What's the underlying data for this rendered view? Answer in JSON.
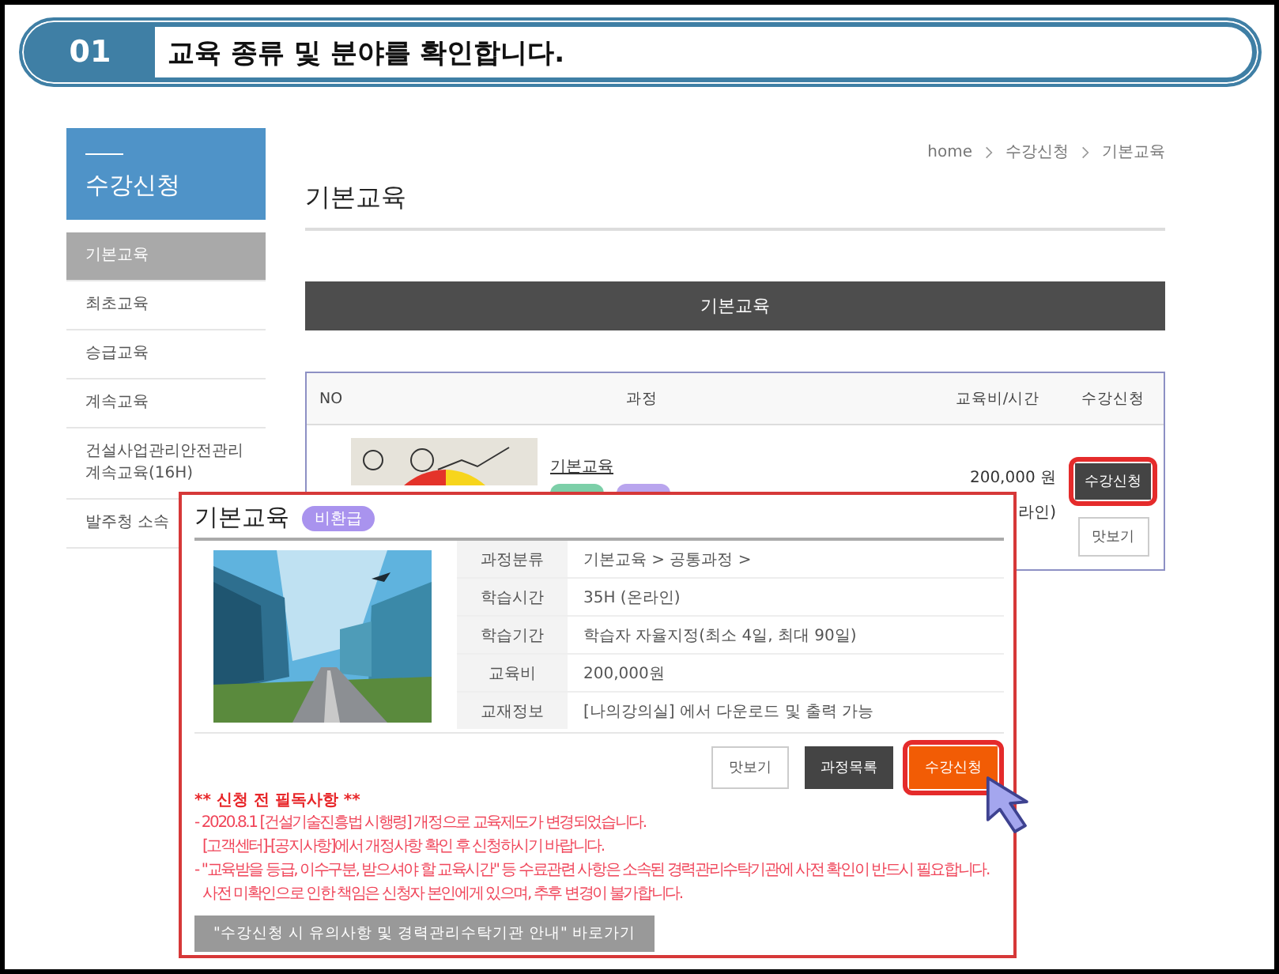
{
  "step": {
    "number": "01",
    "title": "교육 종류 및 분야를 확인합니다."
  },
  "sidebar": {
    "title": "수강신청",
    "items": [
      {
        "label": "기본교육",
        "selected": true
      },
      {
        "label": "최초교육",
        "selected": false
      },
      {
        "label": "승급교육",
        "selected": false
      },
      {
        "label": "계속교육",
        "selected": false
      },
      {
        "label": "건설사업관리안전관리 계속교육(16H)",
        "selected": false
      },
      {
        "label": "발주청 소속",
        "selected": false
      }
    ]
  },
  "breadcrumb": [
    "home",
    "수강신청",
    "기본교육"
  ],
  "page_title": "기본교육",
  "category_bar": "기본교육",
  "table": {
    "columns": [
      "NO",
      "과정",
      "교육비/시간",
      "수강신청"
    ],
    "rows": [
      {
        "course": "기본교육",
        "price": "200,000 원",
        "duration": "라인)",
        "apply_button": {
          "label": "수강신청",
          "highlighted": true
        },
        "preview_button": "맛보기"
      }
    ]
  },
  "popup": {
    "title": "기본교육",
    "badge": "비환급",
    "details": [
      {
        "label": "과정분류",
        "value": "기본교육 > 공통과정 >"
      },
      {
        "label": "학습시간",
        "value": "35H (온라인)"
      },
      {
        "label": "학습기간",
        "value": "학습자 자율지정(최소 4일, 최대 90일)"
      },
      {
        "label": "교육비",
        "value": "200,000원"
      },
      {
        "label": "교재정보",
        "value": "[나의강의실] 에서 다운로드 및 출력 가능"
      }
    ],
    "buttons": [
      {
        "label": "맛보기",
        "kind": "outline",
        "highlighted": false
      },
      {
        "label": "과정목록",
        "kind": "dark",
        "highlighted": false
      },
      {
        "label": "수강신청",
        "kind": "primary",
        "highlighted": true
      }
    ],
    "notice_title": "** 신청 전 필독사항 **",
    "notices": [
      {
        "kind": "item",
        "text": "- 2020.8.1 [건설기술진흥법 시행령] 개정으로 교육제도가 변경되었습니다."
      },
      {
        "kind": "continuation",
        "text": "[고객센터]-[공지사항]에서 개정사항 확인 후 신청하시기 바랍니다."
      },
      {
        "kind": "item",
        "text": "- \"교육받을 등급, 이수구분, 받으셔야 할 교육시간\" 등 수료관련 사항은 소속된 경력관리수탁기관에 사전 확인이 반드시 필요합니다."
      },
      {
        "kind": "continuation",
        "text": "사전 미확인으로 인한 책임은 신청자 본인에게 있으며, 추후 변경이 불가합니다."
      }
    ],
    "guide_link": "\"수강신청 시 유의사항 및 경력관리수탁기관 안내\" 바로가기"
  }
}
